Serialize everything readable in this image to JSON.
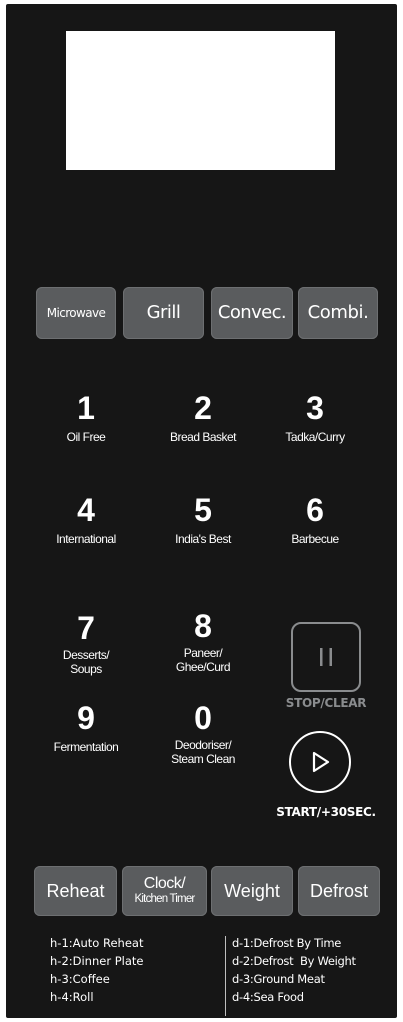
{
  "mode_buttons": [
    {
      "label": "Microwave"
    },
    {
      "label": "Grill"
    },
    {
      "label": "Convec."
    },
    {
      "label": "Combi."
    }
  ],
  "keys": [
    {
      "num": "1",
      "label": "Oil Free"
    },
    {
      "num": "2",
      "label": "Bread Basket"
    },
    {
      "num": "3",
      "label": "Tadka/Curry"
    },
    {
      "num": "4",
      "label": "International"
    },
    {
      "num": "5",
      "label": "India's Best"
    },
    {
      "num": "6",
      "label": "Barbecue"
    },
    {
      "num": "7",
      "label_line1": "Desserts/",
      "label_line2": "Soups"
    },
    {
      "num": "8",
      "label_line1": "Paneer/",
      "label_line2": "Ghee/Curd"
    },
    {
      "num": "9",
      "label": "Fermentation"
    },
    {
      "num": "0",
      "label_line1": "Deodoriser/",
      "label_line2": "Steam Clean"
    }
  ],
  "stop": {
    "label": "STOP/CLEAR"
  },
  "start": {
    "label": "START/+30SEC."
  },
  "bottom_buttons": {
    "reheat": "Reheat",
    "clock_line1": "Clock/",
    "clock_line2": "Kitchen Timer",
    "weight": "Weight",
    "defrost": "Defrost"
  },
  "reheat_list": [
    "h-1:Auto Reheat",
    "h-2:Dinner Plate",
    "h-3:Coffee",
    "h-4:Roll"
  ],
  "defrost_list": [
    "d-1:Defrost By Time",
    "d-2:Defrost  By Weight",
    "d-3:Ground Meat",
    "d-4:Sea Food"
  ],
  "icons": {
    "stop": "pause-icon",
    "start": "play-icon"
  },
  "colors": {
    "panel": "#161616",
    "button": "#5a5c5e",
    "display": "#ffffff",
    "stop_outline": "#8a8c8e"
  }
}
